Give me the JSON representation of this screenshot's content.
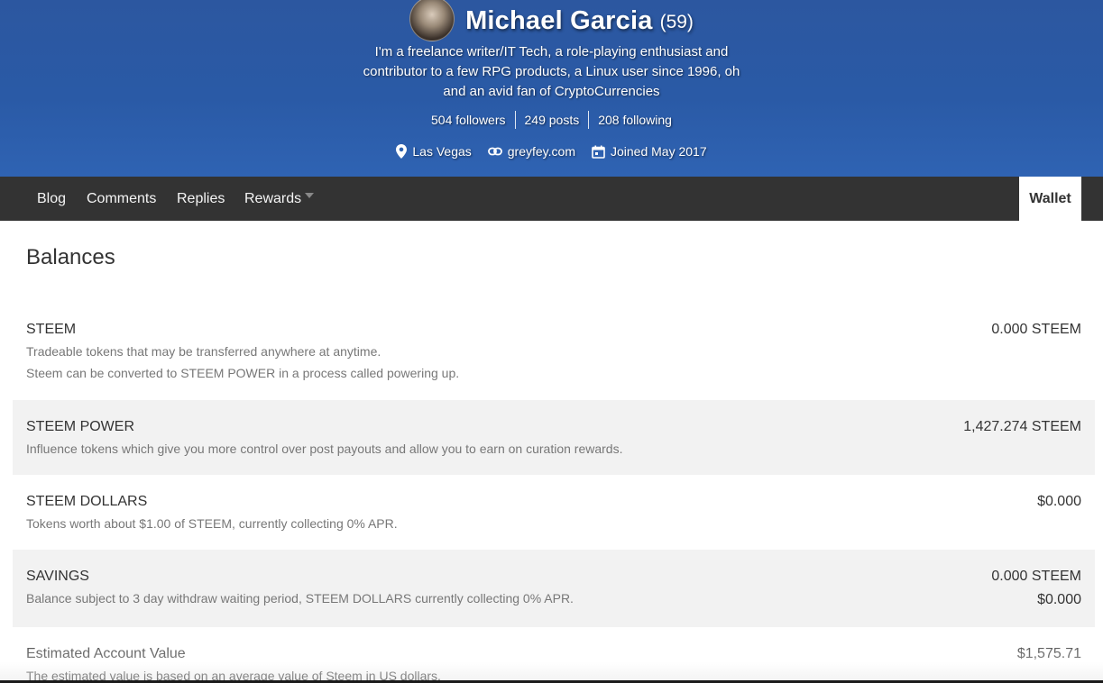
{
  "profile": {
    "name": "Michael Garcia",
    "reputation": "(59)",
    "about": "I'm a freelance writer/IT Tech, a role-playing enthusiast and contributor to a few RPG products, a Linux user since 1996, oh and an avid fan of CryptoCurrencies",
    "followers": "504 followers",
    "posts": "249 posts",
    "following": "208 following",
    "location": "Las Vegas",
    "website": "greyfey.com",
    "joined": "Joined May 2017",
    "icons": {
      "location": "map-pin-icon",
      "website": "link-icon",
      "joined": "calendar-icon"
    }
  },
  "nav": {
    "tabs": [
      {
        "label": "Blog"
      },
      {
        "label": "Comments"
      },
      {
        "label": "Replies"
      },
      {
        "label": "Rewards"
      }
    ],
    "wallet": "Wallet"
  },
  "balances": {
    "heading": "Balances",
    "steem": {
      "label": "STEEM",
      "desc1": "Tradeable tokens that may be transferred anywhere at anytime.",
      "desc2": "Steem can be converted to STEEM POWER in a process called powering up.",
      "amount": "0.000 STEEM"
    },
    "steem_power": {
      "label": "STEEM POWER",
      "desc": "Influence tokens which give you more control over post payouts and allow you to earn on curation rewards.",
      "amount": "1,427.274 STEEM"
    },
    "steem_dollars": {
      "label": "STEEM DOLLARS",
      "desc": "Tokens worth about $1.00 of STEEM, currently collecting 0% APR.",
      "amount": "$0.000"
    },
    "savings": {
      "label": "SAVINGS",
      "desc": "Balance subject to 3 day withdraw waiting period, STEEM DOLLARS currently collecting 0% APR.",
      "amount_steem": "0.000 STEEM",
      "amount_sbd": "$0.000"
    },
    "estimated": {
      "label": "Estimated Account Value",
      "desc": "The estimated value is based on an average value of Steem in US dollars.",
      "amount": "$1,575.71"
    }
  },
  "colors": {
    "hero_blue": "#2a5aa6",
    "nav_bg": "#333333",
    "row_shade": "#f2f2f2"
  }
}
